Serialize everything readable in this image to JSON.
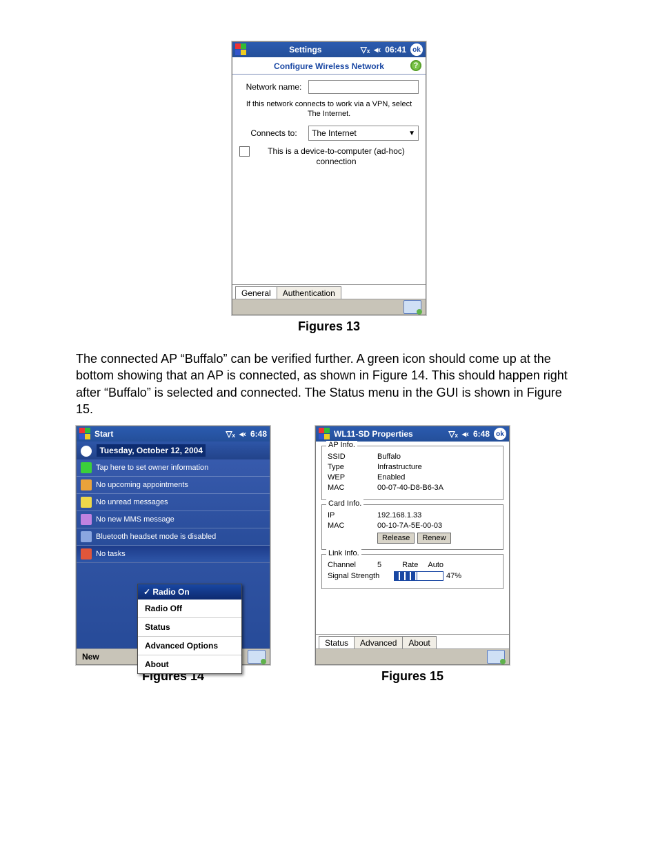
{
  "fig13": {
    "titlebar": {
      "title": "Settings",
      "time": "06:41",
      "ok": "ok"
    },
    "header": "Configure Wireless Network",
    "netname_label": "Network name:",
    "netname_value": "",
    "vpn_note": "If this network connects to work via a VPN, select The Internet.",
    "connects_label": "Connects to:",
    "connects_value": "The Internet",
    "adhoc_label": "This is a device-to-computer (ad-hoc) connection",
    "tabs": [
      "General",
      "Authentication"
    ],
    "caption": "Figures 13"
  },
  "bodytext": "The connected AP “Buffalo” can be verified further.  A green icon should come up at the bottom showing that an AP is connected, as shown in Figure 14. This should happen right after “Buffalo” is selected and connected.  The Status menu in the GUI is shown in Figure 15.",
  "fig14": {
    "titlebar": {
      "title": "Start",
      "time": "6:48"
    },
    "date": "Tuesday, October 12, 2004",
    "items": [
      "Tap here to set owner information",
      "No upcoming appointments",
      "No unread messages",
      "No new MMS message",
      "Bluetooth headset mode is disabled"
    ],
    "notasks": "No tasks",
    "popup_header": "✓ Radio On",
    "popup_items": [
      "Radio Off",
      "Status",
      "Advanced Options",
      "About"
    ],
    "new": "New",
    "caption": "Figures 14"
  },
  "fig15": {
    "titlebar": {
      "title": "WL11-SD Properties",
      "time": "6:48",
      "ok": "ok"
    },
    "ap_legend": "AP Info.",
    "ap": {
      "SSID": "Buffalo",
      "Type": "Infrastructure",
      "WEP": "Enabled",
      "MAC": "00-07-40-D8-B6-3A"
    },
    "card_legend": "Card Info.",
    "card": {
      "IP": "192.168.1.33",
      "MAC": "00-10-7A-5E-00-03"
    },
    "release": "Release",
    "renew": "Renew",
    "link_legend": "Link Info.",
    "link": {
      "channel_label": "Channel",
      "channel": "5",
      "rate_label": "Rate",
      "rate": "Auto",
      "signal_label": "Signal Strength",
      "signal_pct": "47%"
    },
    "tabs": [
      "Status",
      "Advanced",
      "About"
    ],
    "caption": "Figures 15"
  },
  "chart_data": {
    "type": "table",
    "title": "WL11-SD Properties — Status",
    "series": [
      {
        "name": "AP Info",
        "values": {
          "SSID": "Buffalo",
          "Type": "Infrastructure",
          "WEP": "Enabled",
          "MAC": "00-07-40-D8-B6-3A"
        }
      },
      {
        "name": "Card Info",
        "values": {
          "IP": "192.168.1.33",
          "MAC": "00-10-7A-5E-00-03"
        }
      },
      {
        "name": "Link Info",
        "values": {
          "Channel": 5,
          "Rate": "Auto",
          "Signal Strength %": 47
        }
      }
    ]
  }
}
